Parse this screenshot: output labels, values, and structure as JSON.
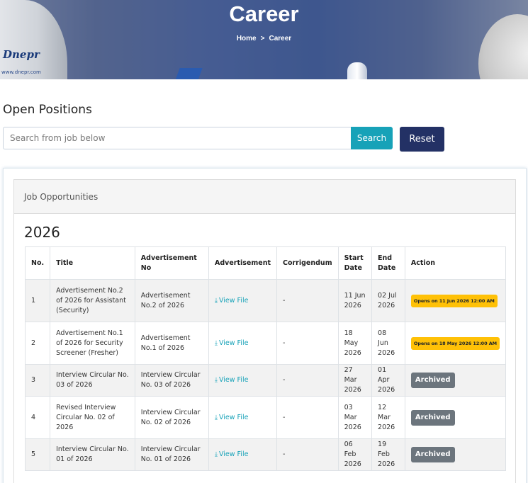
{
  "banner": {
    "title": "Career",
    "breadcrumb": {
      "home": "Home",
      "separator": ">",
      "current": "Career"
    },
    "rocket_text": "Dnepr",
    "rocket_small_text": "www.dnepr.com"
  },
  "positions": {
    "heading": "Open Positions",
    "search_placeholder": "Search from job below",
    "search_label": "Search",
    "reset_label": "Reset"
  },
  "card": {
    "header": "Job Opportunities",
    "year": "2026",
    "columns": [
      "No.",
      "Title",
      "Advertisement No",
      "Advertisement",
      "Corrigendum",
      "Start Date",
      "End Date",
      "Action"
    ],
    "rows": [
      {
        "no": "1",
        "title": "Advertisement No.2 of 2026 for Assistant (Security)",
        "adv_no": "Advertisement No.2 of 2026",
        "file": "View File",
        "corrigendum": "-",
        "start": "11 Jun 2026",
        "end": "02 Jul 2026",
        "action": "Opens on 11 Jun 2026 12:00 AM",
        "action_type": "open"
      },
      {
        "no": "2",
        "title": "Advertisement No.1 of 2026 for Security Screener (Fresher)",
        "adv_no": "Advertisement No.1 of 2026",
        "file": "View File",
        "corrigendum": "-",
        "start": "18 May 2026",
        "end": "08 Jun 2026",
        "action": "Opens on 18 May 2026 12:00 AM",
        "action_type": "open"
      },
      {
        "no": "3",
        "title": "Interview Circular No. 03 of 2026",
        "adv_no": "Interview Circular No. 03 of 2026",
        "file": "View File",
        "corrigendum": "-",
        "start": "27 Mar 2026",
        "end": "01 Apr 2026",
        "action": "Archived",
        "action_type": "archived"
      },
      {
        "no": "4",
        "title": "Revised Interview Circular No. 02 of 2026",
        "adv_no": "Interview Circular No. 02 of 2026",
        "file": "View File",
        "corrigendum": "-",
        "start": "03 Mar 2026",
        "end": "12 Mar 2026",
        "action": "Archived",
        "action_type": "archived"
      },
      {
        "no": "5",
        "title": "Interview Circular No. 01 of 2026",
        "adv_no": "Interview Circular No. 01 of 2026",
        "file": "View File",
        "corrigendum": "-",
        "start": "06 Feb 2026",
        "end": "19 Feb 2026",
        "action": "Archived",
        "action_type": "archived"
      }
    ]
  },
  "colors": {
    "accent": "#17a2b8",
    "reset_bg": "#233165",
    "badge_open": "#ffc107",
    "badge_archived": "#6c757d"
  }
}
